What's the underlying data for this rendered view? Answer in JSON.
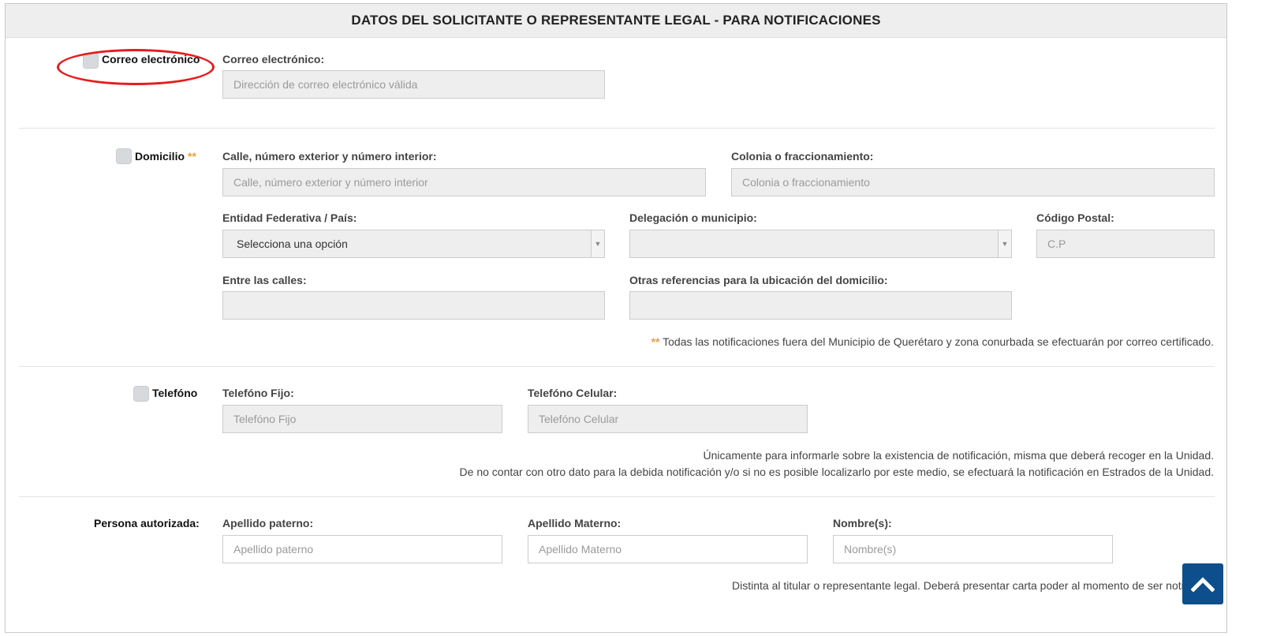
{
  "header": {
    "title": "DATOS DEL SOLICITANTE O REPRESENTANTE LEGAL - PARA NOTIFICACIONES"
  },
  "email": {
    "option_label": "Correo electrónico",
    "field_label": "Correo electrónico:",
    "placeholder": "Dirección de correo electrónico válida"
  },
  "address": {
    "option_label": "Domicilio",
    "option_asterisk": "**",
    "street_label": "Calle, número exterior y número interior:",
    "street_placeholder": "Calle, número exterior y número interior",
    "colony_label": "Colonia o fraccionamiento:",
    "colony_placeholder": "Colonia o fraccionamiento",
    "state_label": "Entidad Federativa / País:",
    "state_selected": "Selecciona una opción",
    "municipality_label": "Delegación o municipio:",
    "municipality_selected": "",
    "zip_label": "Código Postal:",
    "zip_placeholder": "C.P",
    "between_label": "Entre las calles:",
    "references_label": "Otras referencias para la ubicación del domicilio:",
    "note_asterisk": "**",
    "note": "Todas las notificaciones fuera del Municipio de Querétaro y zona conurbada se efectuarán por correo certificado."
  },
  "phone": {
    "option_label": "Telefóno",
    "landline_label": "Telefóno Fijo:",
    "landline_placeholder": "Telefóno Fijo",
    "mobile_label": "Telefóno Celular:",
    "mobile_placeholder": "Telefóno Celular",
    "note_line1": "Únicamente para informarle sobre la existencia de notificación, misma que deberá recoger en la Unidad.",
    "note_line2": "De no contar con otro dato para la debida notificación y/o si no es posible localizarlo por este medio, se efectuará la notificación en Estrados de la Unidad."
  },
  "authorized": {
    "section_label": "Persona autorizada:",
    "paternal_label": "Apellido paterno:",
    "paternal_placeholder": "Apellido paterno",
    "maternal_label": "Apellido Materno:",
    "maternal_placeholder": "Apellido Materno",
    "names_label": "Nombre(s):",
    "names_placeholder": "Nombre(s)",
    "note": "Distinta al titular o representante legal. Deberá presentar carta poder al momento de ser notificado."
  },
  "icons": {
    "scroll_top": "chevron-up-icon",
    "select_arrow": "caret-down-icon"
  },
  "colors": {
    "highlight": "#e41d1d",
    "scroll_button": "#0c4f8c",
    "asterisk": "#f0a030"
  }
}
